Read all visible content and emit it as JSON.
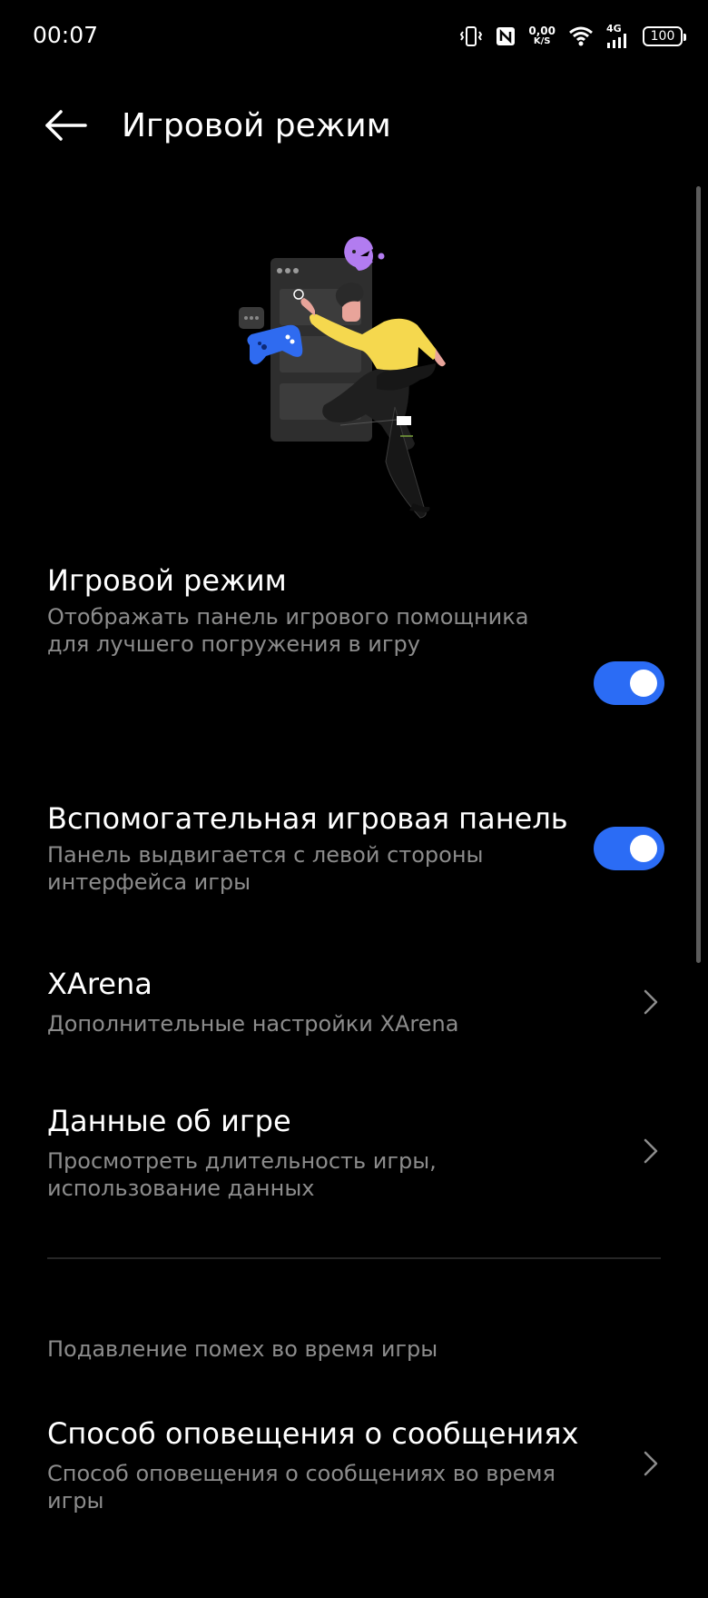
{
  "status_bar": {
    "time": "00:07",
    "net_speed_value": "0,00",
    "net_speed_unit": "K/S",
    "network_type": "4G",
    "battery": "100"
  },
  "header": {
    "title": "Игровой режим"
  },
  "settings": [
    {
      "title": "Игровой режим",
      "description": "Отображать панель игрового помощника для лучшего погружения в игру",
      "control": "toggle",
      "enabled": true
    },
    {
      "title": "Вспомогательная игровая панель",
      "description": "Панель выдвигается с левой стороны интерфейса игры",
      "control": "toggle",
      "enabled": true
    },
    {
      "title": "XArena",
      "description": "Дополнительные настройки XArena",
      "control": "chevron"
    },
    {
      "title": "Данные об игре",
      "description": "Просмотреть длительность игры, использование данных",
      "control": "chevron"
    }
  ],
  "section": {
    "header": "Подавление помех во время игры",
    "items": [
      {
        "title": "Способ оповещения о сообщениях",
        "description": "Способ оповещения о сообщениях во время игры",
        "control": "chevron"
      }
    ]
  },
  "colors": {
    "background": "#000000",
    "accent": "#2B6CF5",
    "secondary_text": "#8C8C8C",
    "illustration_shirt": "#F5D84E",
    "illustration_gamepad": "#2F6BF0",
    "illustration_pacman": "#B27CF0"
  },
  "icons": {
    "back": "arrow-left-icon",
    "chevron": "chevron-right-icon",
    "vibrate": "vibrate-icon",
    "nfc": "nfc-icon",
    "wifi": "wifi-icon",
    "signal": "signal-icon",
    "battery": "battery-icon"
  }
}
